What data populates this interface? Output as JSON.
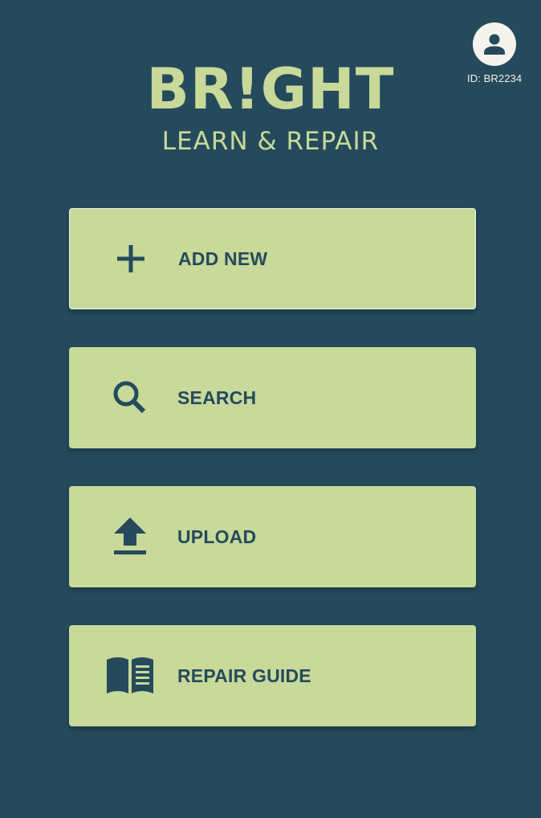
{
  "profile": {
    "user_id": "ID: BR2234"
  },
  "brand": {
    "logo_text": "BR!GHT",
    "tagline": "LEARN & REPAIR"
  },
  "menu": {
    "items": [
      {
        "label": "ADD NEW",
        "icon": "plus-icon"
      },
      {
        "label": "SEARCH",
        "icon": "search-icon"
      },
      {
        "label": "UPLOAD",
        "icon": "upload-icon"
      },
      {
        "label": "REPAIR GUIDE",
        "icon": "book-icon"
      }
    ]
  },
  "colors": {
    "background": "#254A5C",
    "accent": "#C8D99A",
    "text_dark": "#254A5C",
    "avatar_bg": "#F6F2EE"
  }
}
